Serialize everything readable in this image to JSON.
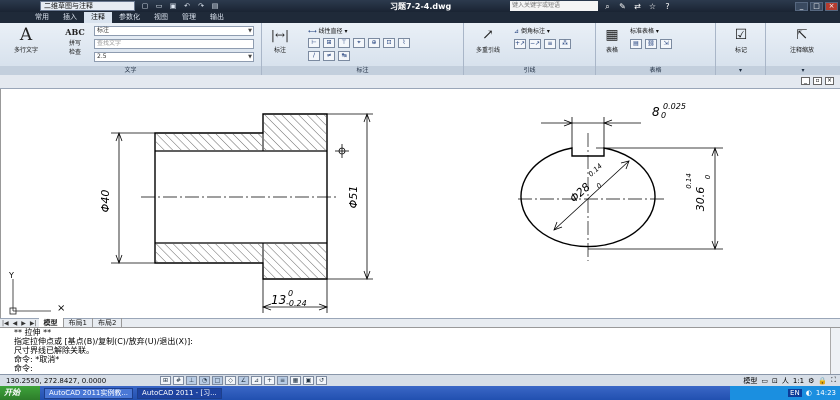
{
  "titlebar": {
    "workspace": "二维草图与注释",
    "document": "习题7-2-4.dwg",
    "search_placeholder": "键入关键字或短语",
    "qa_icons": [
      "new-icon",
      "open-icon",
      "save-icon",
      "undo-icon",
      "redo-icon",
      "print-icon"
    ]
  },
  "menubar": {
    "tabs": [
      "常用",
      "插入",
      "注释",
      "参数化",
      "视图",
      "管理",
      "输出"
    ],
    "active": "注释"
  },
  "ribbon": {
    "text_panel": {
      "title": "文字",
      "mtext": "多行文字",
      "spell": "拼写\n检查",
      "style": "标注",
      "find": "查找文字",
      "height": "2.5"
    },
    "dim_panel": {
      "title": "标注",
      "dim": "标注",
      "linear": "线性直径"
    },
    "leader_panel": {
      "title": "引线",
      "mleader": "多重引线",
      "style": "倒角标注"
    },
    "table_panel": {
      "title": "表格",
      "table": "表格",
      "style": "标准表格"
    },
    "markup_panel": {
      "title": "",
      "mark": "标记"
    },
    "scale_panel": {
      "title": "",
      "scale": "注释缩放"
    }
  },
  "drawing": {
    "dims": {
      "d40": "Φ40",
      "d51": "Φ51",
      "len_base": "13",
      "len_upper": "0",
      "len_lower": "-0.24",
      "key_base": "8",
      "key_upper": "0.025",
      "key_lower": "0",
      "circ_base": "Φ28",
      "circ_upper": "0.14",
      "circ_lower": "0",
      "h_base": "30.6",
      "h_upper": "0.14",
      "h_lower": "0"
    }
  },
  "layout": {
    "tabs": [
      "模型",
      "布局1",
      "布局2"
    ],
    "active": "模型"
  },
  "command": {
    "lines": [
      "** 拉伸 **",
      "指定拉伸点或 [基点(B)/复制(C)/放弃(U)/退出(X)]:",
      "尺寸界线已解除关联。",
      "命令: *取消*",
      "命令:"
    ]
  },
  "status": {
    "coords": "130.2550, 272.8427, 0.0000",
    "model": "模型",
    "scale": "1:1",
    "label_a": "人"
  },
  "taskbar": {
    "start": "开始",
    "tasks": [
      "AutoCAD 2011实例教...",
      "AutoCAD 2011 - [习..."
    ],
    "lang": "EN",
    "time": "14:23"
  }
}
